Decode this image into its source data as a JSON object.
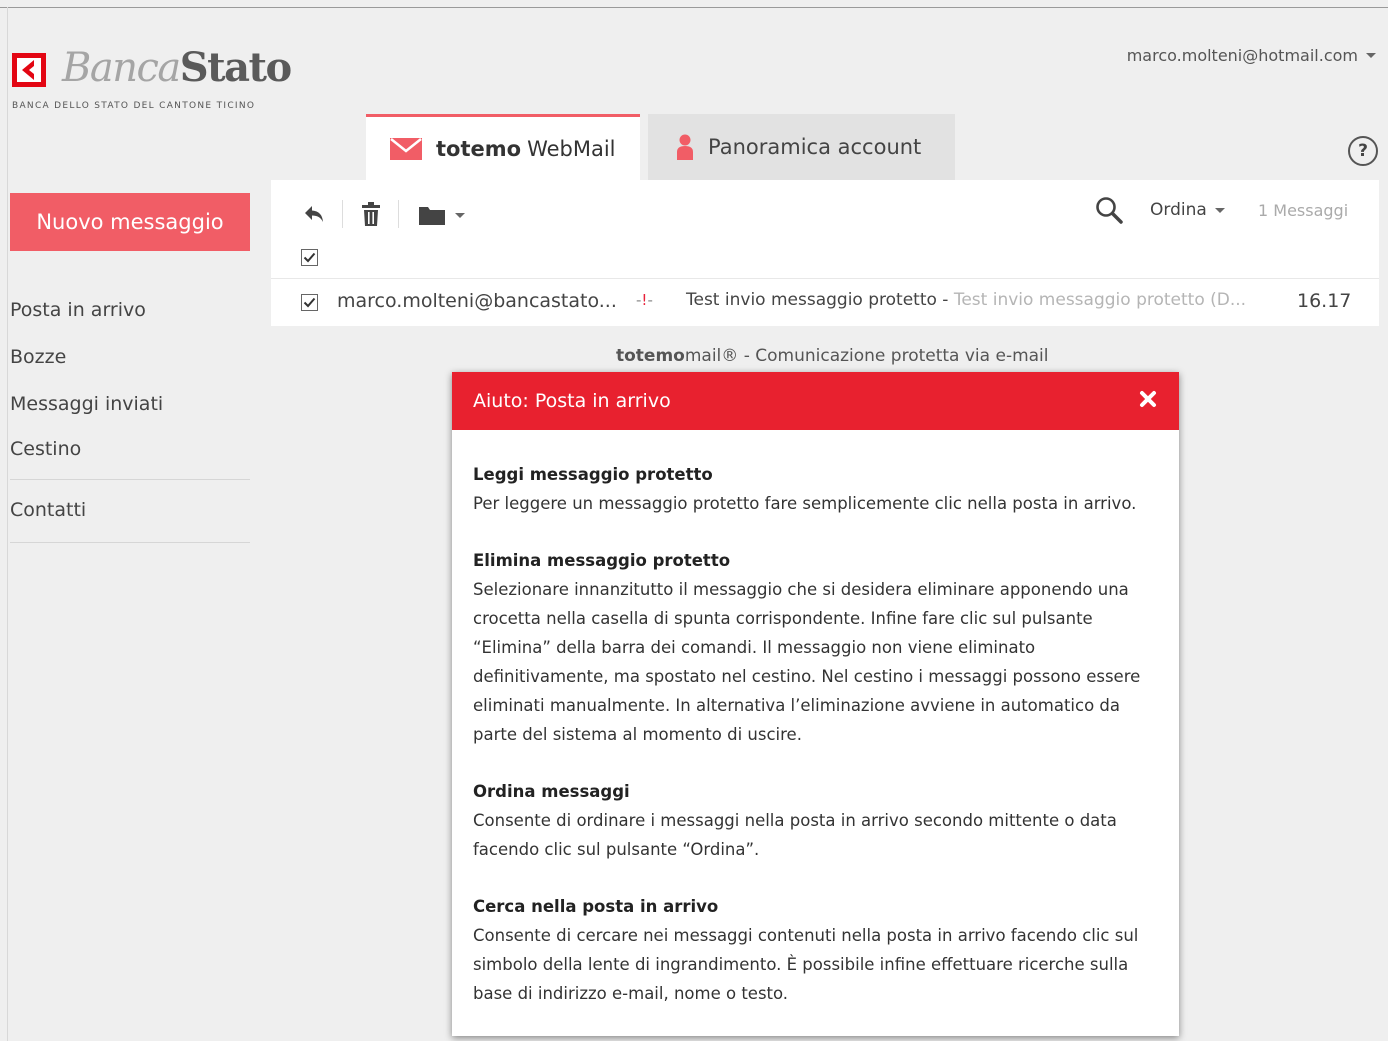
{
  "brand": {
    "name_part1": "Banca",
    "name_part2": "Stato",
    "subtitle": "BANCA DELLO STATO DEL CANTONE TICINO"
  },
  "user": {
    "email": "marco.molteni@hotmail.com"
  },
  "tabs": {
    "webmail_bold": "totemo",
    "webmail_rest": "WebMail",
    "account": "Panoramica account"
  },
  "help_symbol": "?",
  "sidebar": {
    "new_message": "Nuovo messaggio",
    "items": [
      "Posta in arrivo",
      "Bozze",
      "Messaggi inviati",
      "Cestino",
      "Contatti"
    ]
  },
  "toolbar": {
    "sort_label": "Ordina",
    "count": "1 Messaggi",
    "icons": [
      "reply-icon",
      "trash-icon",
      "folder-icon",
      "search-icon"
    ]
  },
  "messages": [
    {
      "sender": "marco.molteni@bancastato...",
      "flag_prefix": "-",
      "flag": "!",
      "flag_suffix": "-",
      "subject": "Test invio messaggio protetto - ",
      "preview": "Test invio messaggio protetto (D...",
      "time": "16.17",
      "checked": true
    }
  ],
  "footer": {
    "brand_bold": "totemo",
    "brand_rest": "mail®",
    "tagline": " -  Comunicazione protetta via e-mail"
  },
  "help_modal": {
    "title": "Aiuto: Posta in arrivo",
    "sections": [
      {
        "title": "Leggi messaggio protetto",
        "text": "Per leggere un messaggio protetto fare semplicemente clic nella posta in arrivo."
      },
      {
        "title": "Elimina messaggio protetto",
        "text": "Selezionare innanzitutto il messaggio che si desidera eliminare apponendo una crocetta nella casella di spunta corrispondente. Infine fare clic sul pulsante “Elimina” della barra dei comandi. Il messaggio non viene eliminato definitivamente, ma spostato nel cestino. Nel cestino i messaggi possono essere eliminati manualmente. In alternativa l’eliminazione avviene in automatico da parte del sistema al momento di uscire."
      },
      {
        "title": "Ordina messaggi",
        "text": "Consente di ordinare i messaggi nella posta in arrivo secondo mittente o data facendo clic sul pulsante “Ordina”."
      },
      {
        "title": "Cerca nella posta in arrivo",
        "text": "Consente di cercare nei messaggi contenuti nella posta in arrivo facendo clic sul simbolo della lente di ingrandimento. È possibile infine effettuare ricerche sulla base di indirizzo e-mail, nome o testo."
      }
    ]
  },
  "colors": {
    "accent": "#f15d66",
    "modal_header": "#e8212f",
    "background": "#efefef"
  }
}
